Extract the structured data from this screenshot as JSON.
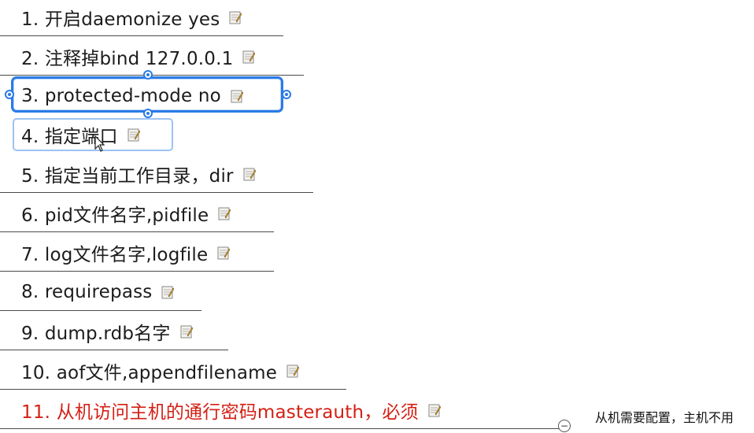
{
  "topics": [
    {
      "label": "1. 开启daemonize yes"
    },
    {
      "label": "2. 注释掉bind 127.0.0.1"
    },
    {
      "label": "3. protected-mode no"
    },
    {
      "label": "4. 指定端口"
    },
    {
      "label": "5. 指定当前工作目录，dir"
    },
    {
      "label": "6. pid文件名字,pidfile"
    },
    {
      "label": "7. log文件名字,logfile"
    },
    {
      "label": "8. requirepass"
    },
    {
      "label": "9. dump.rdb名字"
    },
    {
      "label": "10. aof文件,appendfilename"
    },
    {
      "label": "11. 从机访问主机的通行密码masterauth，必须"
    }
  ],
  "side_note": "从机需要配置，主机不用",
  "collapse_symbol": "−",
  "colors": {
    "text": "#1c1c1c",
    "highlight_text": "#d42015",
    "selection": "#2a7be6",
    "hover": "#9cc3f2",
    "line": "#4a4a4a"
  },
  "icons": {
    "note": "note-icon",
    "cursor": "mouse-pointer-icon",
    "collapse": "collapse-minus-icon"
  }
}
